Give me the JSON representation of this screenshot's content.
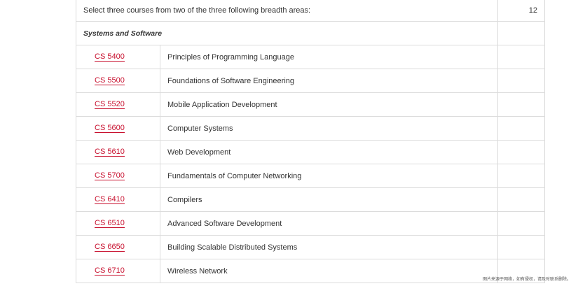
{
  "header": {
    "intro": "Select three courses from two of the three following breadth areas:",
    "credits": "12"
  },
  "section": {
    "title": "Systems and Software"
  },
  "courses": [
    {
      "code": "CS 5400",
      "title": "Principles of Programming Language"
    },
    {
      "code": "CS 5500",
      "title": "Foundations of Software Engineering"
    },
    {
      "code": "CS 5520",
      "title": "Mobile Application Development"
    },
    {
      "code": "CS 5600",
      "title": "Computer Systems"
    },
    {
      "code": "CS 5610",
      "title": "Web Development"
    },
    {
      "code": "CS 5700",
      "title": "Fundamentals of Computer Networking"
    },
    {
      "code": "CS 6410",
      "title": "Compilers"
    },
    {
      "code": "CS 6510",
      "title": "Advanced Software Development"
    },
    {
      "code": "CS 6650",
      "title": "Building Scalable Distributed Systems"
    },
    {
      "code": "CS 6710",
      "title": "Wireless Network"
    }
  ],
  "watermark": "图片来源于网络，如有侵权，请及时联系删除。",
  "colors": {
    "link": "#c8102e",
    "border": "#dcdcdc"
  }
}
